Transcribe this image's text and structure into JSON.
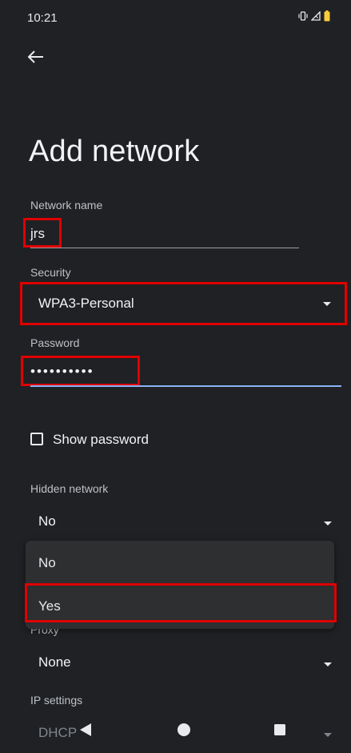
{
  "status_bar": {
    "time": "10:21",
    "icons": [
      "vibrate-icon",
      "signal-icon",
      "battery-icon"
    ]
  },
  "header": {
    "back_icon": "arrow-back-icon",
    "title": "Add network"
  },
  "form": {
    "network_name": {
      "label": "Network name",
      "value": "jrs"
    },
    "security": {
      "label": "Security",
      "value": "WPA3-Personal"
    },
    "password": {
      "label": "Password",
      "value": "••••••••••"
    },
    "show_password": {
      "label": "Show password",
      "checked": false
    },
    "hidden_network": {
      "label": "Hidden network",
      "value": "No"
    },
    "proxy": {
      "label": "Proxy",
      "value": "None"
    },
    "ip_settings": {
      "label": "IP settings",
      "value": "DHCP"
    }
  },
  "hidden_network_menu": {
    "options": [
      "No",
      "Yes"
    ]
  },
  "colors": {
    "background": "#202124",
    "accent": "#8ab4f8",
    "highlight": "#e00000"
  }
}
